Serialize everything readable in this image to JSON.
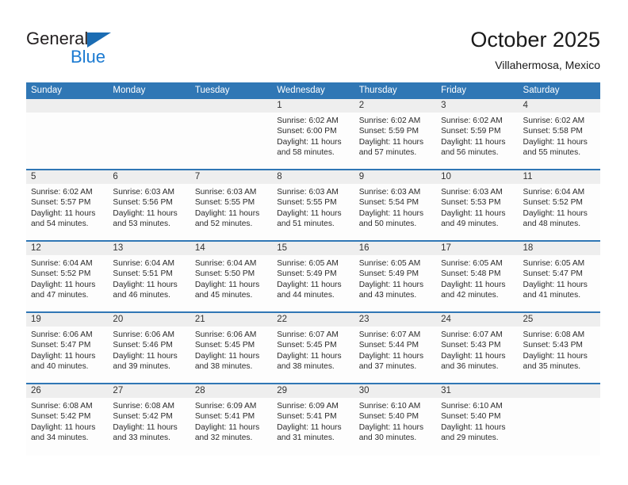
{
  "brand": {
    "name_part1": "General",
    "name_part2": "Blue",
    "triangle_color": "#1b6cb3",
    "blue_color": "#1b7ad1"
  },
  "header": {
    "title": "October 2025",
    "subtitle": "Villahermosa, Mexico"
  },
  "theme": {
    "header_blue": "#3077b5",
    "day_band_gray": "#eeeeee",
    "text_color": "#2b2b2b"
  },
  "weekday_headers": [
    "Sunday",
    "Monday",
    "Tuesday",
    "Wednesday",
    "Thursday",
    "Friday",
    "Saturday"
  ],
  "weeks": [
    [
      {
        "day": "",
        "sunrise": "",
        "sunset": "",
        "daylight_line1": "",
        "daylight_line2": ""
      },
      {
        "day": "",
        "sunrise": "",
        "sunset": "",
        "daylight_line1": "",
        "daylight_line2": ""
      },
      {
        "day": "",
        "sunrise": "",
        "sunset": "",
        "daylight_line1": "",
        "daylight_line2": ""
      },
      {
        "day": "1",
        "sunrise": "Sunrise: 6:02 AM",
        "sunset": "Sunset: 6:00 PM",
        "daylight_line1": "Daylight: 11 hours",
        "daylight_line2": "and 58 minutes."
      },
      {
        "day": "2",
        "sunrise": "Sunrise: 6:02 AM",
        "sunset": "Sunset: 5:59 PM",
        "daylight_line1": "Daylight: 11 hours",
        "daylight_line2": "and 57 minutes."
      },
      {
        "day": "3",
        "sunrise": "Sunrise: 6:02 AM",
        "sunset": "Sunset: 5:59 PM",
        "daylight_line1": "Daylight: 11 hours",
        "daylight_line2": "and 56 minutes."
      },
      {
        "day": "4",
        "sunrise": "Sunrise: 6:02 AM",
        "sunset": "Sunset: 5:58 PM",
        "daylight_line1": "Daylight: 11 hours",
        "daylight_line2": "and 55 minutes."
      }
    ],
    [
      {
        "day": "5",
        "sunrise": "Sunrise: 6:02 AM",
        "sunset": "Sunset: 5:57 PM",
        "daylight_line1": "Daylight: 11 hours",
        "daylight_line2": "and 54 minutes."
      },
      {
        "day": "6",
        "sunrise": "Sunrise: 6:03 AM",
        "sunset": "Sunset: 5:56 PM",
        "daylight_line1": "Daylight: 11 hours",
        "daylight_line2": "and 53 minutes."
      },
      {
        "day": "7",
        "sunrise": "Sunrise: 6:03 AM",
        "sunset": "Sunset: 5:55 PM",
        "daylight_line1": "Daylight: 11 hours",
        "daylight_line2": "and 52 minutes."
      },
      {
        "day": "8",
        "sunrise": "Sunrise: 6:03 AM",
        "sunset": "Sunset: 5:55 PM",
        "daylight_line1": "Daylight: 11 hours",
        "daylight_line2": "and 51 minutes."
      },
      {
        "day": "9",
        "sunrise": "Sunrise: 6:03 AM",
        "sunset": "Sunset: 5:54 PM",
        "daylight_line1": "Daylight: 11 hours",
        "daylight_line2": "and 50 minutes."
      },
      {
        "day": "10",
        "sunrise": "Sunrise: 6:03 AM",
        "sunset": "Sunset: 5:53 PM",
        "daylight_line1": "Daylight: 11 hours",
        "daylight_line2": "and 49 minutes."
      },
      {
        "day": "11",
        "sunrise": "Sunrise: 6:04 AM",
        "sunset": "Sunset: 5:52 PM",
        "daylight_line1": "Daylight: 11 hours",
        "daylight_line2": "and 48 minutes."
      }
    ],
    [
      {
        "day": "12",
        "sunrise": "Sunrise: 6:04 AM",
        "sunset": "Sunset: 5:52 PM",
        "daylight_line1": "Daylight: 11 hours",
        "daylight_line2": "and 47 minutes."
      },
      {
        "day": "13",
        "sunrise": "Sunrise: 6:04 AM",
        "sunset": "Sunset: 5:51 PM",
        "daylight_line1": "Daylight: 11 hours",
        "daylight_line2": "and 46 minutes."
      },
      {
        "day": "14",
        "sunrise": "Sunrise: 6:04 AM",
        "sunset": "Sunset: 5:50 PM",
        "daylight_line1": "Daylight: 11 hours",
        "daylight_line2": "and 45 minutes."
      },
      {
        "day": "15",
        "sunrise": "Sunrise: 6:05 AM",
        "sunset": "Sunset: 5:49 PM",
        "daylight_line1": "Daylight: 11 hours",
        "daylight_line2": "and 44 minutes."
      },
      {
        "day": "16",
        "sunrise": "Sunrise: 6:05 AM",
        "sunset": "Sunset: 5:49 PM",
        "daylight_line1": "Daylight: 11 hours",
        "daylight_line2": "and 43 minutes."
      },
      {
        "day": "17",
        "sunrise": "Sunrise: 6:05 AM",
        "sunset": "Sunset: 5:48 PM",
        "daylight_line1": "Daylight: 11 hours",
        "daylight_line2": "and 42 minutes."
      },
      {
        "day": "18",
        "sunrise": "Sunrise: 6:05 AM",
        "sunset": "Sunset: 5:47 PM",
        "daylight_line1": "Daylight: 11 hours",
        "daylight_line2": "and 41 minutes."
      }
    ],
    [
      {
        "day": "19",
        "sunrise": "Sunrise: 6:06 AM",
        "sunset": "Sunset: 5:47 PM",
        "daylight_line1": "Daylight: 11 hours",
        "daylight_line2": "and 40 minutes."
      },
      {
        "day": "20",
        "sunrise": "Sunrise: 6:06 AM",
        "sunset": "Sunset: 5:46 PM",
        "daylight_line1": "Daylight: 11 hours",
        "daylight_line2": "and 39 minutes."
      },
      {
        "day": "21",
        "sunrise": "Sunrise: 6:06 AM",
        "sunset": "Sunset: 5:45 PM",
        "daylight_line1": "Daylight: 11 hours",
        "daylight_line2": "and 38 minutes."
      },
      {
        "day": "22",
        "sunrise": "Sunrise: 6:07 AM",
        "sunset": "Sunset: 5:45 PM",
        "daylight_line1": "Daylight: 11 hours",
        "daylight_line2": "and 38 minutes."
      },
      {
        "day": "23",
        "sunrise": "Sunrise: 6:07 AM",
        "sunset": "Sunset: 5:44 PM",
        "daylight_line1": "Daylight: 11 hours",
        "daylight_line2": "and 37 minutes."
      },
      {
        "day": "24",
        "sunrise": "Sunrise: 6:07 AM",
        "sunset": "Sunset: 5:43 PM",
        "daylight_line1": "Daylight: 11 hours",
        "daylight_line2": "and 36 minutes."
      },
      {
        "day": "25",
        "sunrise": "Sunrise: 6:08 AM",
        "sunset": "Sunset: 5:43 PM",
        "daylight_line1": "Daylight: 11 hours",
        "daylight_line2": "and 35 minutes."
      }
    ],
    [
      {
        "day": "26",
        "sunrise": "Sunrise: 6:08 AM",
        "sunset": "Sunset: 5:42 PM",
        "daylight_line1": "Daylight: 11 hours",
        "daylight_line2": "and 34 minutes."
      },
      {
        "day": "27",
        "sunrise": "Sunrise: 6:08 AM",
        "sunset": "Sunset: 5:42 PM",
        "daylight_line1": "Daylight: 11 hours",
        "daylight_line2": "and 33 minutes."
      },
      {
        "day": "28",
        "sunrise": "Sunrise: 6:09 AM",
        "sunset": "Sunset: 5:41 PM",
        "daylight_line1": "Daylight: 11 hours",
        "daylight_line2": "and 32 minutes."
      },
      {
        "day": "29",
        "sunrise": "Sunrise: 6:09 AM",
        "sunset": "Sunset: 5:41 PM",
        "daylight_line1": "Daylight: 11 hours",
        "daylight_line2": "and 31 minutes."
      },
      {
        "day": "30",
        "sunrise": "Sunrise: 6:10 AM",
        "sunset": "Sunset: 5:40 PM",
        "daylight_line1": "Daylight: 11 hours",
        "daylight_line2": "and 30 minutes."
      },
      {
        "day": "31",
        "sunrise": "Sunrise: 6:10 AM",
        "sunset": "Sunset: 5:40 PM",
        "daylight_line1": "Daylight: 11 hours",
        "daylight_line2": "and 29 minutes."
      },
      {
        "day": "",
        "sunrise": "",
        "sunset": "",
        "daylight_line1": "",
        "daylight_line2": ""
      }
    ]
  ]
}
